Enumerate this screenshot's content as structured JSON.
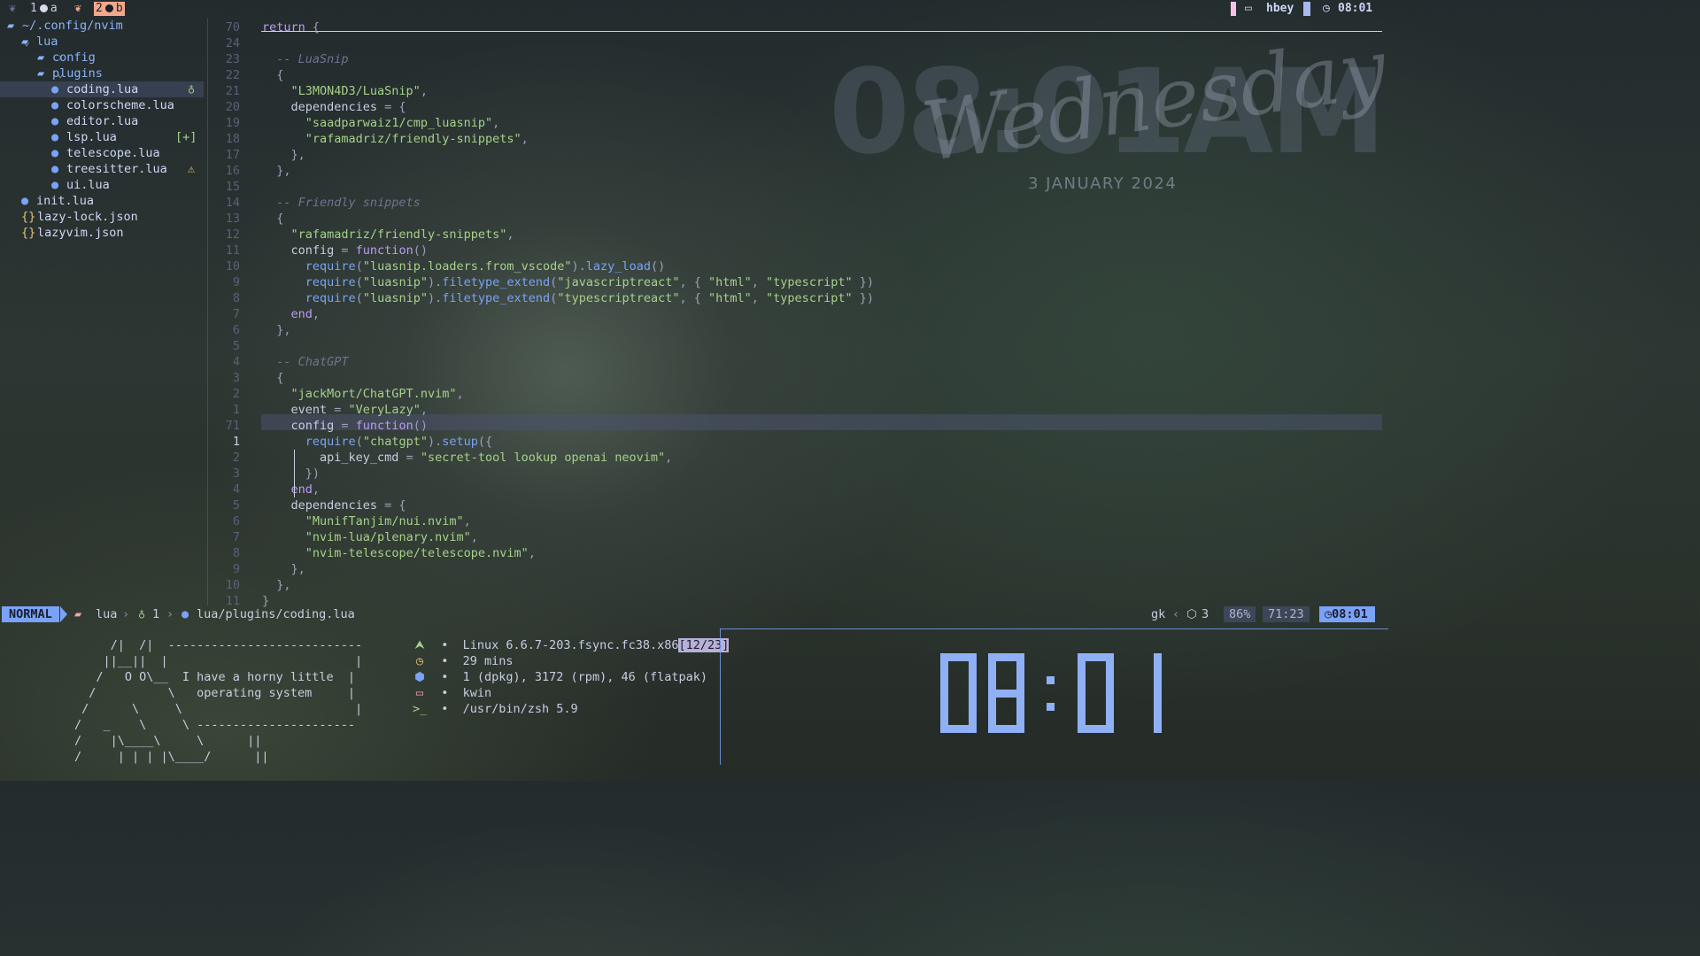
{
  "wallpaper": {
    "time": "08:01AM",
    "day": "Wednesday",
    "date": "3 JANUARY 2024"
  },
  "topbar": {
    "workspaces": [
      {
        "num": "1",
        "letter": "a",
        "active": false
      },
      {
        "num": "2",
        "letter": "b",
        "active": true
      }
    ],
    "user": "hbey",
    "clock": "08:01"
  },
  "explorer": {
    "rows": [
      {
        "indent": 0,
        "chevron": "",
        "icon": "folder",
        "label": "~/.config/nvim",
        "badge": ""
      },
      {
        "indent": 1,
        "chevron": "⌄",
        "icon": "folder",
        "label": "lua",
        "badge": ""
      },
      {
        "indent": 2,
        "chevron": "›",
        "icon": "folder",
        "label": "config",
        "badge": ""
      },
      {
        "indent": 2,
        "chevron": "⌄",
        "icon": "folder",
        "label": "plugins",
        "badge": ""
      },
      {
        "indent": 3,
        "chevron": "",
        "icon": "lua",
        "label": "coding.lua",
        "badge": "bulb",
        "selected": true
      },
      {
        "indent": 3,
        "chevron": "",
        "icon": "lua",
        "label": "colorscheme.lua",
        "badge": ""
      },
      {
        "indent": 3,
        "chevron": "",
        "icon": "lua",
        "label": "editor.lua",
        "badge": ""
      },
      {
        "indent": 3,
        "chevron": "",
        "icon": "lua",
        "label": "lsp.lua",
        "badge": "[+]"
      },
      {
        "indent": 3,
        "chevron": "",
        "icon": "lua",
        "label": "telescope.lua",
        "badge": ""
      },
      {
        "indent": 3,
        "chevron": "",
        "icon": "lua",
        "label": "treesitter.lua",
        "badge": "warn"
      },
      {
        "indent": 3,
        "chevron": "",
        "icon": "lua",
        "label": "ui.lua",
        "badge": ""
      },
      {
        "indent": 1,
        "chevron": "",
        "icon": "lua",
        "label": "init.lua",
        "badge": ""
      },
      {
        "indent": 1,
        "chevron": "",
        "icon": "json",
        "label": "lazy-lock.json",
        "badge": ""
      },
      {
        "indent": 1,
        "chevron": "",
        "icon": "json",
        "label": "lazyvim.json",
        "badge": ""
      }
    ]
  },
  "editor": {
    "cursor_line_index": 26,
    "lines": [
      {
        "num": "70",
        "tokens": [
          [
            "kw",
            "return "
          ],
          [
            "pun",
            "{"
          ]
        ]
      },
      {
        "num": "24",
        "tokens": []
      },
      {
        "num": "23",
        "tokens": [
          [
            "var",
            "  "
          ],
          [
            "cmt",
            "-- LuaSnip"
          ]
        ]
      },
      {
        "num": "22",
        "tokens": [
          [
            "pun",
            "  {"
          ]
        ]
      },
      {
        "num": "21",
        "tokens": [
          [
            "var",
            "    "
          ],
          [
            "str",
            "\"L3MON4D3/LuaSnip\""
          ],
          [
            "pun",
            ","
          ]
        ]
      },
      {
        "num": "20",
        "tokens": [
          [
            "var",
            "    dependencies "
          ],
          [
            "pun",
            "= {"
          ]
        ]
      },
      {
        "num": "19",
        "tokens": [
          [
            "var",
            "      "
          ],
          [
            "str",
            "\"saadparwaiz1/cmp_luasnip\""
          ],
          [
            "pun",
            ","
          ]
        ]
      },
      {
        "num": "18",
        "tokens": [
          [
            "var",
            "      "
          ],
          [
            "str",
            "\"rafamadriz/friendly-snippets\""
          ],
          [
            "pun",
            ","
          ]
        ]
      },
      {
        "num": "17",
        "tokens": [
          [
            "pun",
            "    },"
          ]
        ]
      },
      {
        "num": "16",
        "tokens": [
          [
            "pun",
            "  },"
          ]
        ]
      },
      {
        "num": "15",
        "tokens": []
      },
      {
        "num": "14",
        "tokens": [
          [
            "var",
            "  "
          ],
          [
            "cmt",
            "-- Friendly snippets"
          ]
        ]
      },
      {
        "num": "13",
        "tokens": [
          [
            "pun",
            "  {"
          ]
        ]
      },
      {
        "num": "12",
        "tokens": [
          [
            "var",
            "    "
          ],
          [
            "str",
            "\"rafamadriz/friendly-snippets\""
          ],
          [
            "pun",
            ","
          ]
        ]
      },
      {
        "num": "11",
        "tokens": [
          [
            "var",
            "    config "
          ],
          [
            "pun",
            "= "
          ],
          [
            "kw",
            "function"
          ],
          [
            "pun",
            "()"
          ]
        ]
      },
      {
        "num": "10",
        "tokens": [
          [
            "var",
            "      "
          ],
          [
            "fn",
            "require"
          ],
          [
            "pun",
            "("
          ],
          [
            "str",
            "\"luasnip.loaders.from_vscode\""
          ],
          [
            "pun",
            ")."
          ],
          [
            "fn",
            "lazy_load"
          ],
          [
            "pun",
            "()"
          ]
        ]
      },
      {
        "num": "9",
        "tokens": [
          [
            "var",
            "      "
          ],
          [
            "fn",
            "require"
          ],
          [
            "pun",
            "("
          ],
          [
            "str",
            "\"luasnip\""
          ],
          [
            "pun",
            ")."
          ],
          [
            "fn",
            "filetype_extend"
          ],
          [
            "pun",
            "("
          ],
          [
            "str",
            "\"javascriptreact\""
          ],
          [
            "pun",
            ", { "
          ],
          [
            "str",
            "\"html\""
          ],
          [
            "pun",
            ", "
          ],
          [
            "str",
            "\"typescript\""
          ],
          [
            "pun",
            " })"
          ]
        ]
      },
      {
        "num": "8",
        "tokens": [
          [
            "var",
            "      "
          ],
          [
            "fn",
            "require"
          ],
          [
            "pun",
            "("
          ],
          [
            "str",
            "\"luasnip\""
          ],
          [
            "pun",
            ")."
          ],
          [
            "fn",
            "filetype_extend"
          ],
          [
            "pun",
            "("
          ],
          [
            "str",
            "\"typescriptreact\""
          ],
          [
            "pun",
            ", { "
          ],
          [
            "str",
            "\"html\""
          ],
          [
            "pun",
            ", "
          ],
          [
            "str",
            "\"typescript\""
          ],
          [
            "pun",
            " })"
          ]
        ]
      },
      {
        "num": "7",
        "tokens": [
          [
            "kw",
            "    end"
          ],
          [
            "pun",
            ","
          ]
        ]
      },
      {
        "num": "6",
        "tokens": [
          [
            "pun",
            "  },"
          ]
        ]
      },
      {
        "num": "5",
        "tokens": []
      },
      {
        "num": "4",
        "tokens": [
          [
            "var",
            "  "
          ],
          [
            "cmt",
            "-- ChatGPT"
          ]
        ]
      },
      {
        "num": "3",
        "tokens": [
          [
            "pun",
            "  {"
          ]
        ]
      },
      {
        "num": "2",
        "tokens": [
          [
            "var",
            "    "
          ],
          [
            "str",
            "\"jackMort/ChatGPT.nvim\""
          ],
          [
            "pun",
            ","
          ]
        ]
      },
      {
        "num": "1",
        "tokens": [
          [
            "var",
            "    event "
          ],
          [
            "pun",
            "= "
          ],
          [
            "str",
            "\"VeryLazy\""
          ],
          [
            "pun",
            ","
          ]
        ]
      },
      {
        "num": "71",
        "tokens": [
          [
            "var",
            "    config "
          ],
          [
            "pun",
            "= "
          ],
          [
            "kw",
            "function"
          ],
          [
            "pun",
            "()"
          ]
        ]
      },
      {
        "num": "1",
        "tokens": [
          [
            "var",
            "      "
          ],
          [
            "fn",
            "require"
          ],
          [
            "pun",
            "("
          ],
          [
            "str",
            "\"chatgpt\""
          ],
          [
            "pun",
            ")."
          ],
          [
            "fn",
            "setup"
          ],
          [
            "pun",
            "({"
          ]
        ]
      },
      {
        "num": "2",
        "tokens": [
          [
            "var",
            "        api_key_cmd "
          ],
          [
            "pun",
            "= "
          ],
          [
            "str",
            "\"secret-tool lookup openai neovim\""
          ],
          [
            "pun",
            ","
          ]
        ]
      },
      {
        "num": "3",
        "tokens": [
          [
            "pun",
            "      })"
          ]
        ]
      },
      {
        "num": "4",
        "tokens": [
          [
            "kw",
            "    end"
          ],
          [
            "pun",
            ","
          ]
        ]
      },
      {
        "num": "5",
        "tokens": [
          [
            "var",
            "    dependencies "
          ],
          [
            "pun",
            "= {"
          ]
        ]
      },
      {
        "num": "6",
        "tokens": [
          [
            "var",
            "      "
          ],
          [
            "str",
            "\"MunifTanjim/nui.nvim\""
          ],
          [
            "pun",
            ","
          ]
        ]
      },
      {
        "num": "7",
        "tokens": [
          [
            "var",
            "      "
          ],
          [
            "str",
            "\"nvim-lua/plenary.nvim\""
          ],
          [
            "pun",
            ","
          ]
        ]
      },
      {
        "num": "8",
        "tokens": [
          [
            "var",
            "      "
          ],
          [
            "str",
            "\"nvim-telescope/telescope.nvim\""
          ],
          [
            "pun",
            ","
          ]
        ]
      },
      {
        "num": "9",
        "tokens": [
          [
            "pun",
            "    },"
          ]
        ]
      },
      {
        "num": "10",
        "tokens": [
          [
            "pun",
            "  },"
          ]
        ]
      },
      {
        "num": "11",
        "tokens": [
          [
            "pun",
            "}"
          ]
        ]
      }
    ]
  },
  "statusline": {
    "mode": "NORMAL",
    "dir": "lua",
    "diag": "1",
    "path": "lua/plugins/coding.lua",
    "branch": "gk",
    "packages": "3",
    "percent": "86%",
    "position": "71:23",
    "clock": "08:01"
  },
  "terminal": {
    "ascii": [
      "     /|  /|  ---------------------------",
      "    ||__||  |                          |",
      "   /   O O\\__  I have a horny little  |",
      "  /          \\   operating system     |",
      " /      \\     \\                        |",
      "/   _    \\     \\ ----------------------",
      "/    |\\____\\     \\      ||",
      "/     | | | |\\____/      ||"
    ],
    "fetch": [
      {
        "icon": "arch-icon",
        "glyph": "⮝",
        "text": "Linux 6.6.7-203.fsync.fc38.x86",
        "suffix": "[12/23]"
      },
      {
        "icon": "uptime-icon",
        "glyph": "◷",
        "text": "29 mins",
        "suffix": ""
      },
      {
        "icon": "package-icon",
        "glyph": "⬢",
        "text": "1 (dpkg), 3172 (rpm), 46 (flatpak)",
        "suffix": ""
      },
      {
        "icon": "window-icon",
        "glyph": "▭",
        "text": "kwin",
        "suffix": ""
      },
      {
        "icon": "shell-icon",
        "glyph": ">_",
        "text": "/usr/bin/zsh 5.9",
        "suffix": ""
      }
    ],
    "digital_clock": "08:01"
  },
  "colors": {
    "accent": "#7aa2f7",
    "workspace_active": "#f0a88a",
    "clock_digits": "#8fb0f5"
  }
}
